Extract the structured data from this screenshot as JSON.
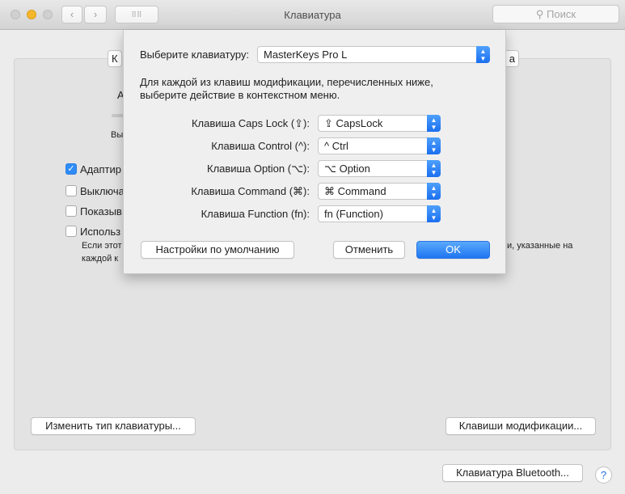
{
  "window": {
    "title": "Клавиатура",
    "search_placeholder": "Поиск",
    "search_icon": "magnifier-icon"
  },
  "background": {
    "tab_left_fragment": "К",
    "tab_right_fragment": "а",
    "heading_fragment": "А",
    "slider_label_fragment": "Вы",
    "checkboxes": [
      {
        "label": "Адаптир",
        "checked": true
      },
      {
        "label": "Выключа",
        "checked": false
      },
      {
        "label": "Показыв",
        "checked": false
      },
      {
        "label": "Использ",
        "checked": false
      }
    ],
    "description_line1": "Если этот",
    "description_line2": "каждой к",
    "description_right": "и, указанные на",
    "change_type_button": "Изменить тип клавиатуры...",
    "modifier_keys_button": "Клавиши модификации...",
    "bluetooth_button": "Клавиатура Bluetooth...",
    "help": "?"
  },
  "sheet": {
    "keyboard_label": "Выберите клавиатуру:",
    "keyboard_value": "MasterKeys Pro L",
    "description_line1": "Для каждой из клавиш модификации, перечисленных ниже,",
    "description_line2": "выберите действие в контекстном меню.",
    "rows": [
      {
        "label": "Клавиша Caps Lock (⇪):",
        "value": "⇪ CapsLock"
      },
      {
        "label": "Клавиша Control (^):",
        "value": "^ Ctrl"
      },
      {
        "label": "Клавиша Option (⌥):",
        "value": "⌥ Option"
      },
      {
        "label": "Клавиша Command (⌘):",
        "value": "⌘ Command"
      },
      {
        "label": "Клавиша Function (fn):",
        "value": "fn (Function)"
      }
    ],
    "defaults_button": "Настройки по умолчанию",
    "cancel_button": "Отменить",
    "ok_button": "OK"
  },
  "colors": {
    "accent": "#1f76f2",
    "minimize": "#f5b72a"
  }
}
